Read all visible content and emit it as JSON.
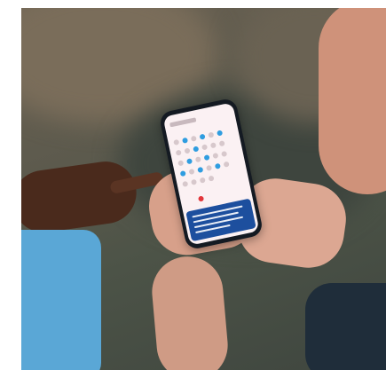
{
  "scene": {
    "description_icons": [
      "photo-icon",
      "smartphone-icon"
    ],
    "colors": {
      "background_sand": "#6b6152",
      "background_green": "#3f463f",
      "phone_body": "#141a22",
      "screen": "#fbf1f3",
      "accent_blue": "#2f9de0",
      "accent_red": "#e2363b",
      "banner_blue": "#1d4f9e"
    }
  }
}
